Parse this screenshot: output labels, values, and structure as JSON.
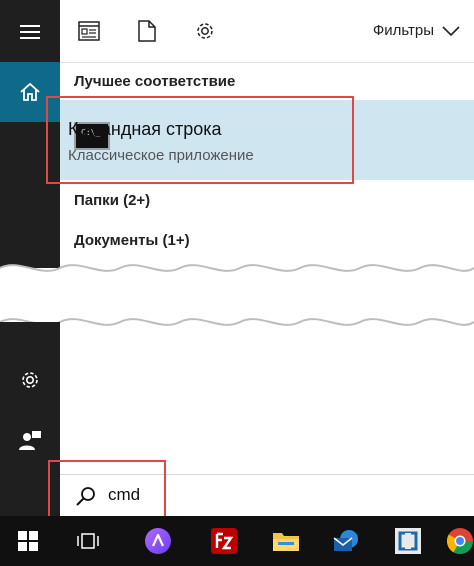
{
  "toolbar": {
    "filters_label": "Фильтры"
  },
  "sections": {
    "best_match": "Лучшее соответствие",
    "folders": "Папки (2+)",
    "documents": "Документы (1+)"
  },
  "result": {
    "title": "Командная строка",
    "subtitle": "Классическое приложение",
    "prompt_glyph": "C:\\_"
  },
  "search": {
    "value": "cmd"
  },
  "colors": {
    "rail": "#1f1f1f",
    "rail_active": "#0f6a8a",
    "result_bg": "#cfe6f1",
    "highlight": "#e04848",
    "taskbar": "#101010"
  }
}
